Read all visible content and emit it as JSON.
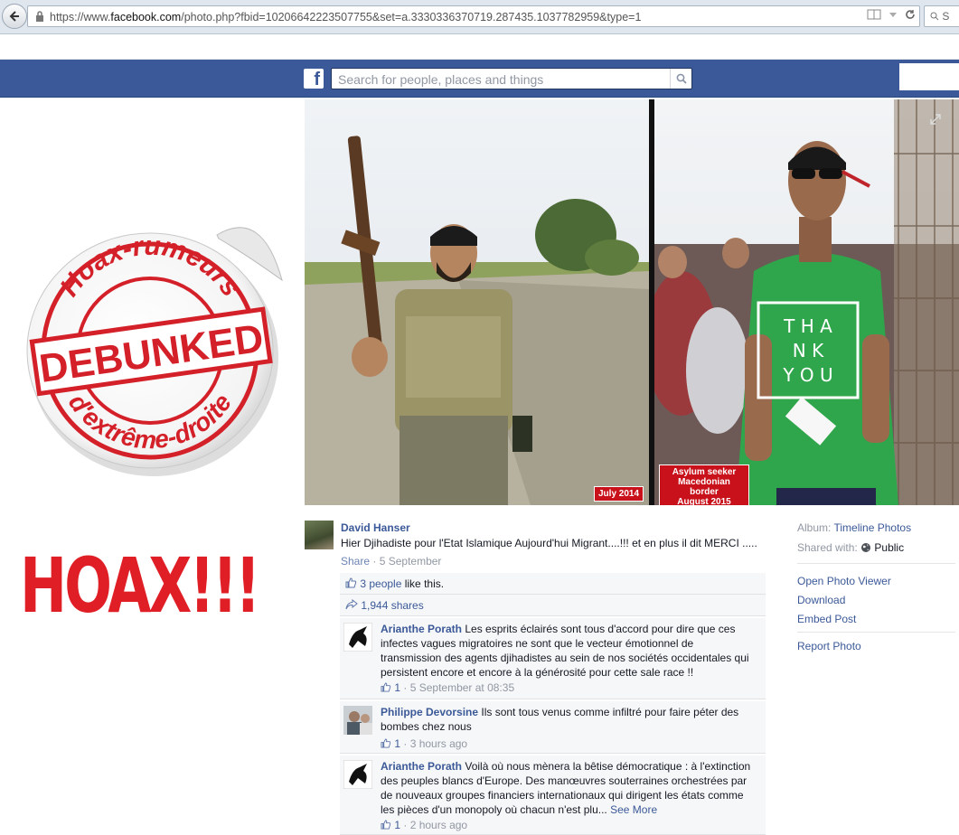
{
  "browser": {
    "url_prefix": "https://www.",
    "url_domain": "facebook.com",
    "url_rest": "/photo.php?fbid=10206642223507755&set=a.3330336370719.287435.1037782959&type=1",
    "search_placeholder": "S"
  },
  "fb": {
    "logo": "f",
    "search_placeholder": "Search for people, places and things"
  },
  "overlay": {
    "sticker_top": "Hoax-rumeurs",
    "sticker_middle": "DEBUNKED",
    "sticker_bottom": "d'extrême-droite",
    "hoax": "HOAX!!!"
  },
  "photo": {
    "left_caption": "July 2014",
    "right_caption_1": "Asylum seeker",
    "right_caption_2": "Macedonian border",
    "right_caption_3": "August 2015",
    "shirt_1": "T H A",
    "shirt_2": "N K",
    "shirt_3": "Y O U"
  },
  "post": {
    "author": "David Hanser",
    "text": "Hier Djihadiste pour l'Etat Islamique Aujourd'hui Migrant....!!! et en plus il dit MERCI .....",
    "share_label": "Share",
    "separator": " · ",
    "date": "5 September"
  },
  "ufi": {
    "likes_link": "3 people",
    "likes_suffix": " like this.",
    "shares": "1,944 shares"
  },
  "comments": [
    {
      "name": "Arianthe Porath",
      "text": "Les esprits éclairés sont tous d'accord pour dire que ces infectes vagues migratoires ne sont que le vecteur émotionnel de transmission des agents djihadistes au sein de nos sociétés occidentales qui persistent encore et encore à la générosité pour cette sale race !!",
      "likes": "1",
      "time": "5 September at 08:35"
    },
    {
      "name": "Philippe Devorsine",
      "text": "Ils sont tous venus comme infiltré pour faire péter des bombes chez nous",
      "likes": "1",
      "time": "3 hours ago"
    },
    {
      "name": "Arianthe Porath",
      "text": "Voilà où nous mènera la bêtise démocratique : à l'extinction des peuples blancs d'Europe. Des manœuvres souterraines orchestrées par de nouveaux groupes financiers internationaux qui dirigent les états comme les pièces d'un monopoly où chacun n'est plu...",
      "see_more": "See More",
      "likes": "1",
      "time": "2 hours ago"
    }
  ],
  "sidebar": {
    "album_label": "Album:",
    "album_value": "Timeline Photos",
    "shared_label": "Shared with:",
    "shared_value": "Public",
    "open_viewer": "Open Photo Viewer",
    "download": "Download",
    "embed": "Embed Post",
    "report": "Report Photo"
  },
  "colors": {
    "fb_blue": "#3b5998",
    "link": "#3b5998",
    "muted": "#9197a3",
    "hoax_red": "#e01e26"
  }
}
